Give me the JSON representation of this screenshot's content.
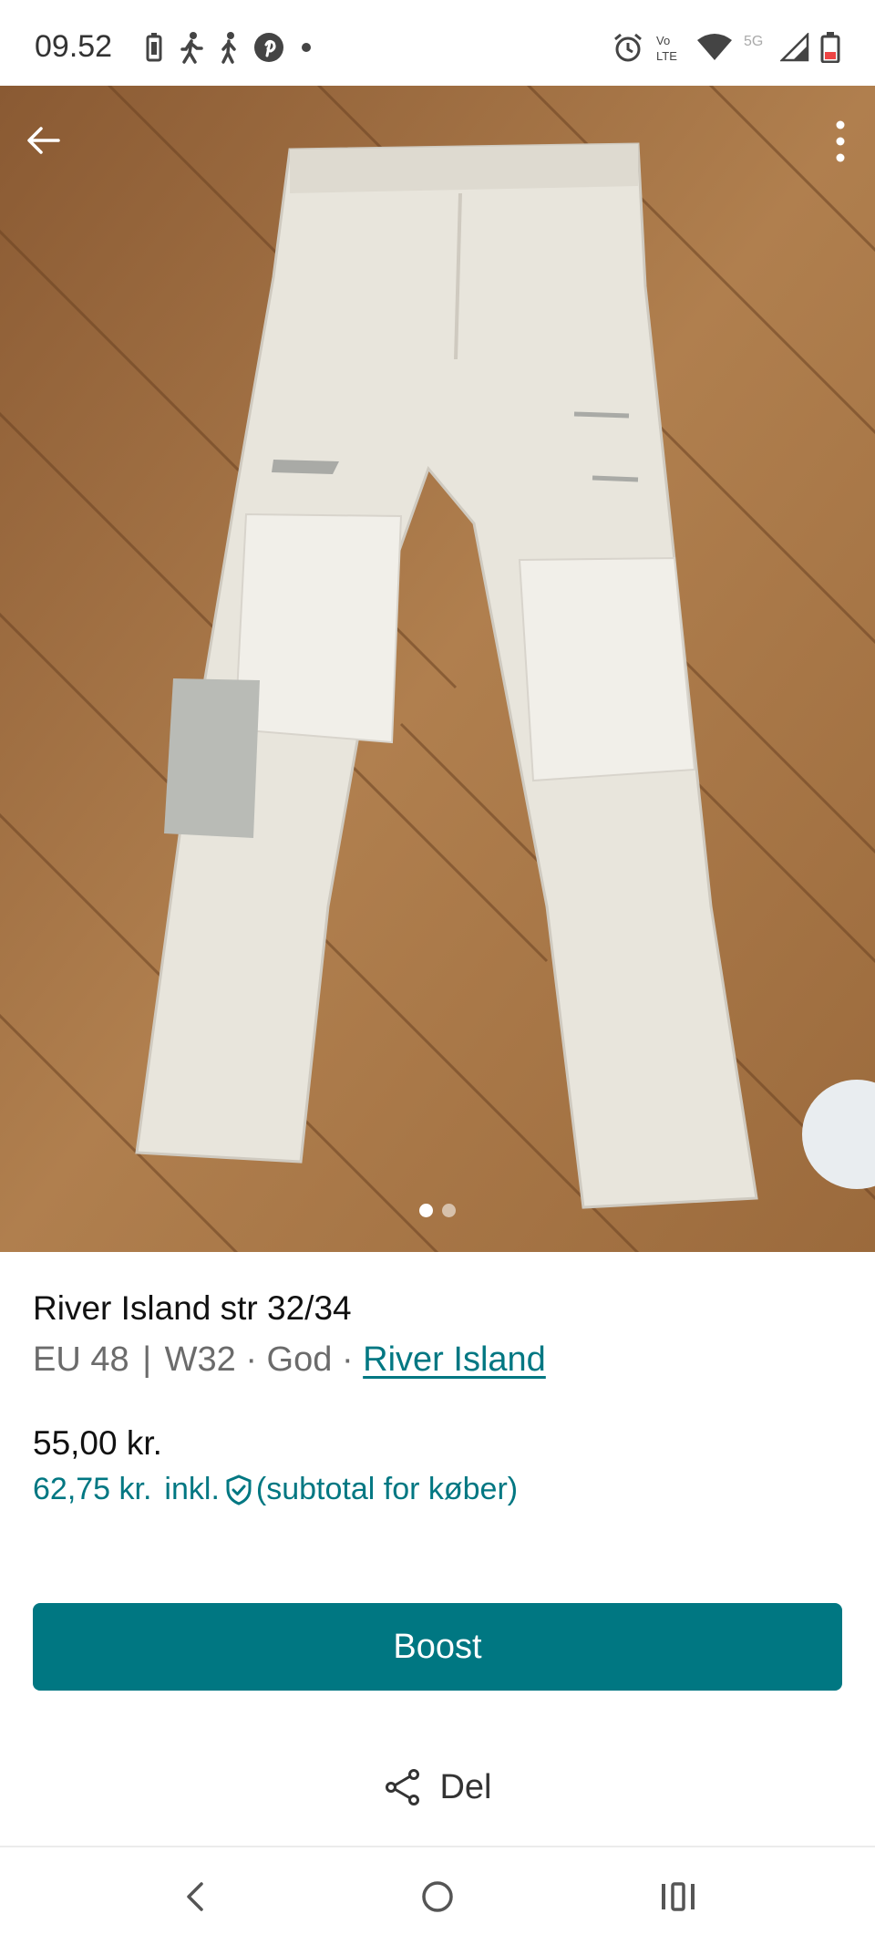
{
  "status_bar": {
    "time": "09.52",
    "left_icons": [
      "battery-saver-icon",
      "walking-icon",
      "walking-icon",
      "pinterest-icon",
      "dot-icon"
    ],
    "right_icons": [
      "alarm-icon",
      "volte-icon",
      "wifi-icon",
      "5g-icon",
      "signal-icon",
      "battery-icon"
    ],
    "network_label": "5G",
    "volte_label": "Vo LTE"
  },
  "hero": {
    "image_description_icon": "photo-jeans",
    "carousel_total": 2,
    "carousel_active": 1
  },
  "listing": {
    "title": "River Island str 32/34",
    "size": "EU 48",
    "divider": "|",
    "waist": "W32",
    "bullet": "·",
    "condition": "God",
    "brand": "River Island",
    "price": "55,00 kr.",
    "buyer_price": "62,75 kr.",
    "buyer_incl": "inkl.",
    "buyer_note": "(subtotal for køber)"
  },
  "actions": {
    "boost_label": "Boost",
    "share_label": "Del"
  },
  "colors": {
    "accent": "#007782",
    "text": "#111111",
    "muted": "#6b6b6b"
  }
}
